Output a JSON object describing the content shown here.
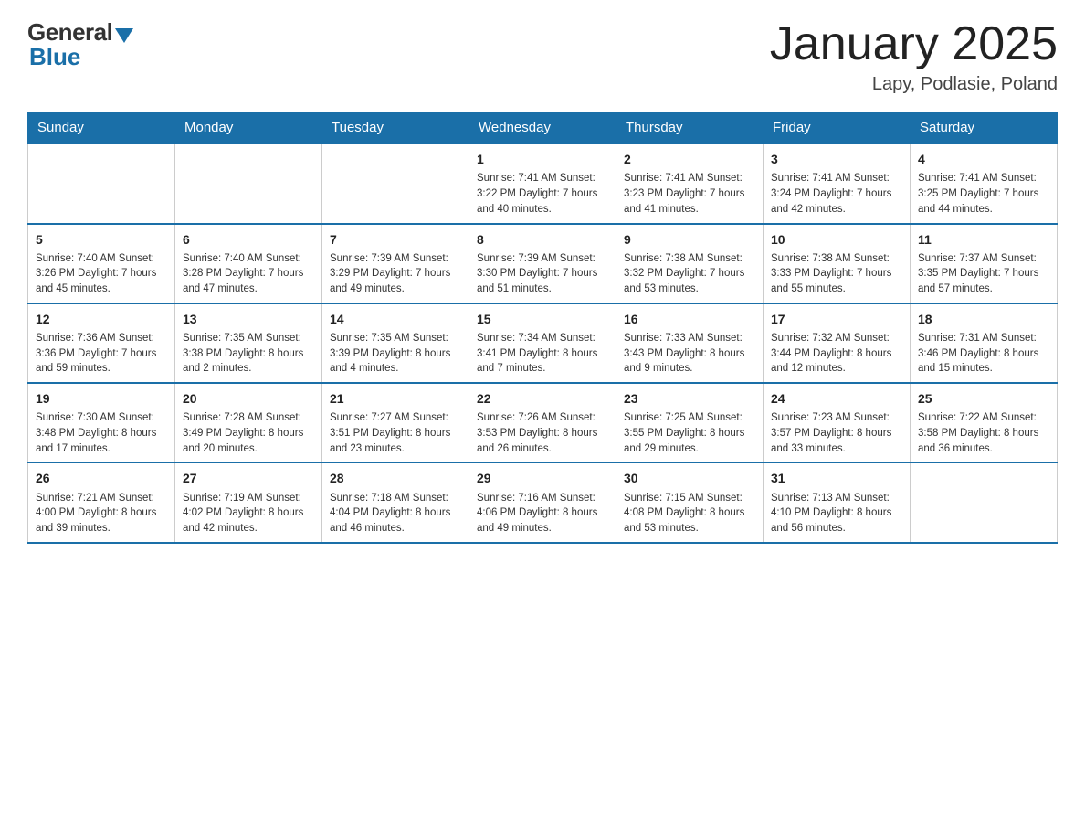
{
  "logo": {
    "general": "General",
    "blue": "Blue"
  },
  "title": "January 2025",
  "subtitle": "Lapy, Podlasie, Poland",
  "days_of_week": [
    "Sunday",
    "Monday",
    "Tuesday",
    "Wednesday",
    "Thursday",
    "Friday",
    "Saturday"
  ],
  "weeks": [
    [
      {
        "day": "",
        "info": ""
      },
      {
        "day": "",
        "info": ""
      },
      {
        "day": "",
        "info": ""
      },
      {
        "day": "1",
        "info": "Sunrise: 7:41 AM\nSunset: 3:22 PM\nDaylight: 7 hours and 40 minutes."
      },
      {
        "day": "2",
        "info": "Sunrise: 7:41 AM\nSunset: 3:23 PM\nDaylight: 7 hours and 41 minutes."
      },
      {
        "day": "3",
        "info": "Sunrise: 7:41 AM\nSunset: 3:24 PM\nDaylight: 7 hours and 42 minutes."
      },
      {
        "day": "4",
        "info": "Sunrise: 7:41 AM\nSunset: 3:25 PM\nDaylight: 7 hours and 44 minutes."
      }
    ],
    [
      {
        "day": "5",
        "info": "Sunrise: 7:40 AM\nSunset: 3:26 PM\nDaylight: 7 hours and 45 minutes."
      },
      {
        "day": "6",
        "info": "Sunrise: 7:40 AM\nSunset: 3:28 PM\nDaylight: 7 hours and 47 minutes."
      },
      {
        "day": "7",
        "info": "Sunrise: 7:39 AM\nSunset: 3:29 PM\nDaylight: 7 hours and 49 minutes."
      },
      {
        "day": "8",
        "info": "Sunrise: 7:39 AM\nSunset: 3:30 PM\nDaylight: 7 hours and 51 minutes."
      },
      {
        "day": "9",
        "info": "Sunrise: 7:38 AM\nSunset: 3:32 PM\nDaylight: 7 hours and 53 minutes."
      },
      {
        "day": "10",
        "info": "Sunrise: 7:38 AM\nSunset: 3:33 PM\nDaylight: 7 hours and 55 minutes."
      },
      {
        "day": "11",
        "info": "Sunrise: 7:37 AM\nSunset: 3:35 PM\nDaylight: 7 hours and 57 minutes."
      }
    ],
    [
      {
        "day": "12",
        "info": "Sunrise: 7:36 AM\nSunset: 3:36 PM\nDaylight: 7 hours and 59 minutes."
      },
      {
        "day": "13",
        "info": "Sunrise: 7:35 AM\nSunset: 3:38 PM\nDaylight: 8 hours and 2 minutes."
      },
      {
        "day": "14",
        "info": "Sunrise: 7:35 AM\nSunset: 3:39 PM\nDaylight: 8 hours and 4 minutes."
      },
      {
        "day": "15",
        "info": "Sunrise: 7:34 AM\nSunset: 3:41 PM\nDaylight: 8 hours and 7 minutes."
      },
      {
        "day": "16",
        "info": "Sunrise: 7:33 AM\nSunset: 3:43 PM\nDaylight: 8 hours and 9 minutes."
      },
      {
        "day": "17",
        "info": "Sunrise: 7:32 AM\nSunset: 3:44 PM\nDaylight: 8 hours and 12 minutes."
      },
      {
        "day": "18",
        "info": "Sunrise: 7:31 AM\nSunset: 3:46 PM\nDaylight: 8 hours and 15 minutes."
      }
    ],
    [
      {
        "day": "19",
        "info": "Sunrise: 7:30 AM\nSunset: 3:48 PM\nDaylight: 8 hours and 17 minutes."
      },
      {
        "day": "20",
        "info": "Sunrise: 7:28 AM\nSunset: 3:49 PM\nDaylight: 8 hours and 20 minutes."
      },
      {
        "day": "21",
        "info": "Sunrise: 7:27 AM\nSunset: 3:51 PM\nDaylight: 8 hours and 23 minutes."
      },
      {
        "day": "22",
        "info": "Sunrise: 7:26 AM\nSunset: 3:53 PM\nDaylight: 8 hours and 26 minutes."
      },
      {
        "day": "23",
        "info": "Sunrise: 7:25 AM\nSunset: 3:55 PM\nDaylight: 8 hours and 29 minutes."
      },
      {
        "day": "24",
        "info": "Sunrise: 7:23 AM\nSunset: 3:57 PM\nDaylight: 8 hours and 33 minutes."
      },
      {
        "day": "25",
        "info": "Sunrise: 7:22 AM\nSunset: 3:58 PM\nDaylight: 8 hours and 36 minutes."
      }
    ],
    [
      {
        "day": "26",
        "info": "Sunrise: 7:21 AM\nSunset: 4:00 PM\nDaylight: 8 hours and 39 minutes."
      },
      {
        "day": "27",
        "info": "Sunrise: 7:19 AM\nSunset: 4:02 PM\nDaylight: 8 hours and 42 minutes."
      },
      {
        "day": "28",
        "info": "Sunrise: 7:18 AM\nSunset: 4:04 PM\nDaylight: 8 hours and 46 minutes."
      },
      {
        "day": "29",
        "info": "Sunrise: 7:16 AM\nSunset: 4:06 PM\nDaylight: 8 hours and 49 minutes."
      },
      {
        "day": "30",
        "info": "Sunrise: 7:15 AM\nSunset: 4:08 PM\nDaylight: 8 hours and 53 minutes."
      },
      {
        "day": "31",
        "info": "Sunrise: 7:13 AM\nSunset: 4:10 PM\nDaylight: 8 hours and 56 minutes."
      },
      {
        "day": "",
        "info": ""
      }
    ]
  ]
}
